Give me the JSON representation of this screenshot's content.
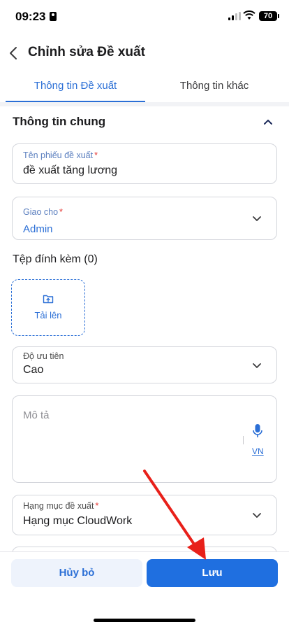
{
  "status_bar": {
    "time": "09:23",
    "battery": "70"
  },
  "header": {
    "title": "Chỉnh sửa Đề xuất"
  },
  "tabs": [
    {
      "label": "Thông tin Đề xuất",
      "active": true
    },
    {
      "label": "Thông tin khác",
      "active": false
    }
  ],
  "section": {
    "title": "Thông tin chung"
  },
  "fields": {
    "proposal_name": {
      "label": "Tên phiếu đề xuất",
      "required_mark": "*",
      "value": "đề xuất tăng lương"
    },
    "assign_to": {
      "label": "Giao cho",
      "required_mark": "*",
      "value": "Admin"
    },
    "priority": {
      "label": "Độ ưu tiên",
      "value": "Cao"
    },
    "description": {
      "placeholder": "Mô tả",
      "voice_lang": "VN"
    },
    "category": {
      "label": "Hạng mục đề xuất",
      "required_mark": "*",
      "value": "Hạng mục CloudWork"
    }
  },
  "attachments": {
    "title": "Tệp đính kèm (0)",
    "upload_label": "Tải lên"
  },
  "actions": {
    "cancel_label": "Hủy bỏ",
    "save_label": "Lưu"
  },
  "colors": {
    "accent": "#2b6fd6",
    "primary_button": "#1f6fe0",
    "required": "#e53935",
    "annotation_arrow": "#e8201a"
  },
  "icons": [
    "back-chevron-icon",
    "chevron-up-icon",
    "chevron-down-icon",
    "folder-upload-icon",
    "microphone-icon"
  ]
}
